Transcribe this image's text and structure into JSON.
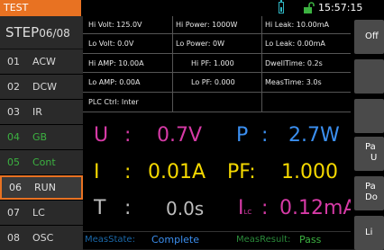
{
  "topbar": {
    "title": "TEST",
    "time": "15:57:15"
  },
  "sidebar": {
    "step_label": "STEP",
    "step_value": "06/08",
    "items": [
      {
        "num": "01",
        "label": "ACW"
      },
      {
        "num": "02",
        "label": "DCW"
      },
      {
        "num": "03",
        "label": "IR"
      },
      {
        "num": "04",
        "label": "GB"
      },
      {
        "num": "05",
        "label": "Cont"
      },
      {
        "num": "06",
        "label": "RUN"
      },
      {
        "num": "07",
        "label": "LC"
      },
      {
        "num": "08",
        "label": "OSC"
      }
    ]
  },
  "params": {
    "hi_volt_label": "Hi Volt:",
    "hi_volt_value": "125.0V",
    "hi_power_label": "Hi Power:",
    "hi_power_value": "1000W",
    "hi_leak_label": "Hi Leak:",
    "hi_leak_value": "10.00mA",
    "lo_volt_label": "Lo Volt:",
    "lo_volt_value": "0.0V",
    "lo_power_label": "Lo Power:",
    "lo_power_value": "0W",
    "lo_leak_label": "Lo Leak:",
    "lo_leak_value": "0.00mA",
    "hi_amp_label": "Hi AMP:",
    "hi_amp_value": "10.00A",
    "hi_pf_label": "Hi PF:",
    "hi_pf_value": "1.000",
    "dwell_label": "DwellTime:",
    "dwell_value": "0.2s",
    "lo_amp_label": "Lo AMP:",
    "lo_amp_value": "0.00A",
    "lo_pf_label": "Lo PF:",
    "lo_pf_value": "0.000",
    "meas_time_label": "MeasTime:",
    "meas_time_value": "3.0s",
    "plc_label": "PLC Ctrl:",
    "plc_value": "Inter"
  },
  "readings": {
    "u_label": "U",
    "u_value": "0.7V",
    "p_label": "P",
    "p_value": "2.7W",
    "i_label": "I",
    "i_value": "0.01A",
    "pf_label": "PF:",
    "pf_value": "1.000",
    "t_label": "T",
    "t_value": "0.0s",
    "lc_label": "I",
    "lc_sub": "LC",
    "lc_value": "0.12mA",
    "colon": ":"
  },
  "status": {
    "meas_state_label": "MeasState:",
    "meas_state_value": "Complete",
    "meas_result_label": "MeasResult:",
    "meas_result_value": "Pass"
  },
  "right_buttons": [
    {
      "label": "Off"
    },
    {
      "label": ""
    },
    {
      "label": ""
    },
    {
      "label": "Pa",
      "label2": "U"
    },
    {
      "label": "Pa",
      "label2": "Do"
    },
    {
      "label": "Li"
    }
  ],
  "colors": {
    "accent": "#e87222",
    "label": "#d63aa6",
    "value": "#3b8ff0",
    "highlight": "#f4d800",
    "green": "#3cb241"
  }
}
